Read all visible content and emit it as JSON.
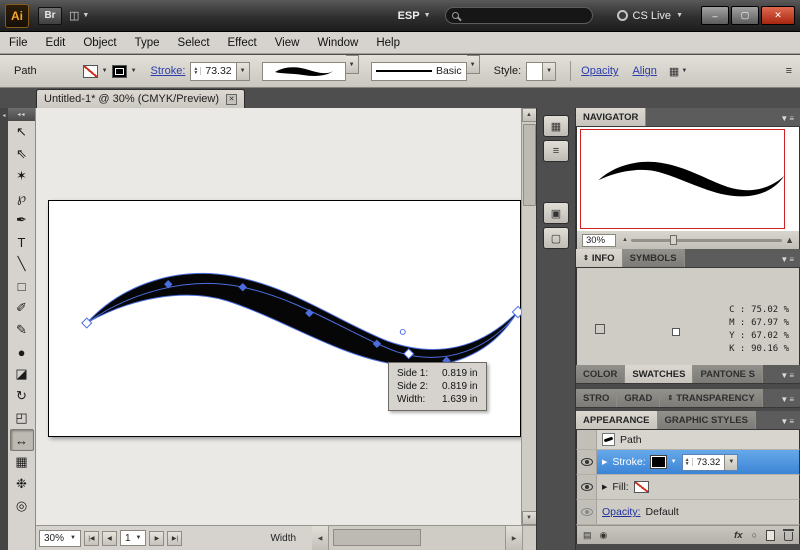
{
  "titlebar": {
    "app_logo": "Ai",
    "bridge": "Br",
    "language": "ESP",
    "cs_live": "CS Live",
    "minimize": "–",
    "restore": "▢",
    "close": "✕"
  },
  "menubar": {
    "items": [
      "File",
      "Edit",
      "Object",
      "Type",
      "Select",
      "Effect",
      "View",
      "Window",
      "Help"
    ]
  },
  "control_bar": {
    "selection_label": "Path",
    "stroke_link": "Stroke:",
    "stroke_weight": "73.32",
    "brush_name": "Basic",
    "style_label": "Style:",
    "opacity_link": "Opacity",
    "align_link": "Align"
  },
  "document_tab": {
    "title": "Untitled-1* @ 30% (CMYK/Preview)",
    "close": "✕"
  },
  "tools": {
    "items": [
      {
        "name": "selection",
        "glyph": "↖"
      },
      {
        "name": "direct-selection",
        "glyph": "⇖"
      },
      {
        "name": "magic-wand",
        "glyph": "✶"
      },
      {
        "name": "lasso",
        "glyph": "℘"
      },
      {
        "name": "pen",
        "glyph": "✒"
      },
      {
        "name": "type",
        "glyph": "T"
      },
      {
        "name": "line-segment",
        "glyph": "╲"
      },
      {
        "name": "rectangle",
        "glyph": "□"
      },
      {
        "name": "paintbrush",
        "glyph": "✐"
      },
      {
        "name": "pencil",
        "glyph": "✎"
      },
      {
        "name": "blob-brush",
        "glyph": "●"
      },
      {
        "name": "eraser",
        "glyph": "◪"
      },
      {
        "name": "rotate",
        "glyph": "↻"
      },
      {
        "name": "scale",
        "glyph": "◰"
      },
      {
        "name": "width",
        "glyph": "↔"
      },
      {
        "name": "gradient",
        "glyph": "▦"
      },
      {
        "name": "blend",
        "glyph": "❉"
      },
      {
        "name": "zoom",
        "glyph": "◎"
      }
    ]
  },
  "tooltip": {
    "rows": [
      {
        "label": "Side 1:",
        "value": "0.819 in"
      },
      {
        "label": "Side 2:",
        "value": "0.819 in"
      },
      {
        "label": "Width:",
        "value": "1.639 in"
      }
    ]
  },
  "status_bar": {
    "zoom": "30%",
    "page": "1",
    "tool_name": "Width"
  },
  "panels": {
    "navigator": {
      "title": "NAVIGATOR",
      "zoom": "30%"
    },
    "info": {
      "tab_info": "INFO",
      "tab_symbols": "SYMBOLS",
      "values": [
        {
          "label": "C :",
          "value": "75.02 %"
        },
        {
          "label": "M :",
          "value": "67.97 %"
        },
        {
          "label": "Y :",
          "value": "67.02 %"
        },
        {
          "label": "K :",
          "value": "90.16 %"
        }
      ]
    },
    "color_row": {
      "tabs": [
        "COLOR",
        "SWATCHES",
        "PANTONE S"
      ]
    },
    "stroke_row": {
      "tabs": [
        "STRO",
        "GRAD",
        "TRANSPARENCY"
      ]
    },
    "appearance": {
      "tab_appearance": "APPEARANCE",
      "tab_graphic_styles": "GRAPHIC STYLES",
      "path_label": "Path",
      "stroke_label": "Stroke:",
      "stroke_weight": "73.32",
      "fill_label": "Fill:",
      "opacity_label": "Opacity:",
      "opacity_value": "Default",
      "fx": "fx"
    }
  }
}
